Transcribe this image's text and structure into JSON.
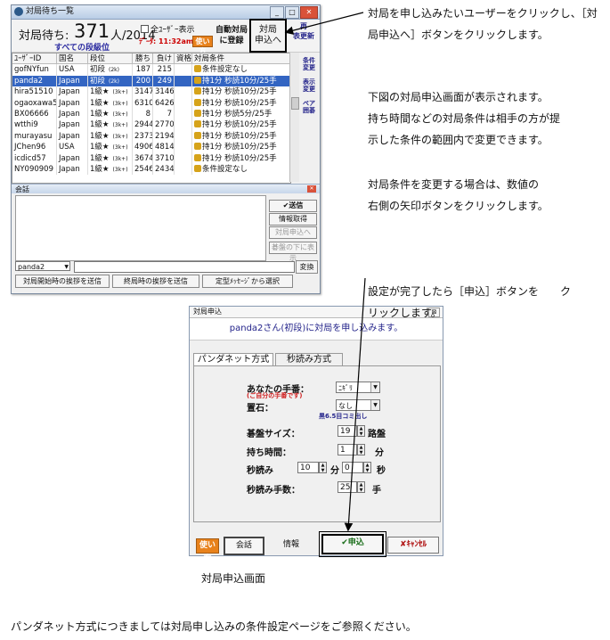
{
  "window": {
    "title": "対局待ち一覧",
    "wait_label": "対局待ち:",
    "wait_count": "371",
    "wait_unit": "人/2014",
    "wait_sub": "すべての段級位",
    "all_users_label": "全ﾕｰｻﾞｰ表示",
    "data_time": "ﾃﾞｰﾀ: 11:32am",
    "usage_btn": "使い方",
    "auto_btn_lines": [
      "自動対局",
      "に登録"
    ],
    "request_btn_lines": [
      "対局",
      "申込へ"
    ],
    "side_buttons": [
      "条件変更",
      "表示変更",
      "ペア囲碁"
    ],
    "side_top_lines": [
      "再",
      "表更新"
    ],
    "columns": [
      "ﾕｰｻﾞｰID",
      "国名",
      "段位",
      "勝ち",
      "負け",
      "資格",
      "対局条件"
    ],
    "rows": [
      {
        "id": "gofNYfun",
        "country": "USA",
        "rank": "初段",
        "rank_note": "(2k)",
        "win": "187",
        "loss": "215",
        "cond": "条件設定なし",
        "selected": false
      },
      {
        "id": "panda2",
        "country": "Japan",
        "rank": "初段",
        "rank_note": "(2k)",
        "win": "200",
        "loss": "249",
        "cond": "持1分 秒読10分/25手",
        "selected": true
      },
      {
        "id": "hira51510",
        "country": "Japan",
        "rank": "1級★",
        "rank_note": "(3k+)",
        "win": "3147",
        "loss": "3146",
        "cond": "持1分 秒読10分/25手",
        "selected": false
      },
      {
        "id": "ogaoxawa57",
        "country": "Japan",
        "rank": "1級★",
        "rank_note": "(3k+)",
        "win": "6310",
        "loss": "6426",
        "cond": "持1分 秒読10分/25手",
        "selected": false
      },
      {
        "id": "BX06666",
        "country": "Japan",
        "rank": "1級★",
        "rank_note": "(3k+)",
        "win": "8",
        "loss": "7",
        "cond": "持1分 秒読5分/25手",
        "selected": false
      },
      {
        "id": "wtthi9",
        "country": "Japan",
        "rank": "1級★",
        "rank_note": "(3k+)",
        "win": "2944",
        "loss": "2770",
        "cond": "持1分 秒読10分/25手",
        "selected": false
      },
      {
        "id": "murayasu",
        "country": "Japan",
        "rank": "1級★",
        "rank_note": "(3k+)",
        "win": "2373",
        "loss": "2194",
        "cond": "持1分 秒読10分/25手",
        "selected": false
      },
      {
        "id": "JChen96",
        "country": "USA",
        "rank": "1級★",
        "rank_note": "(3k+)",
        "win": "4906",
        "loss": "4814",
        "cond": "持1分 秒読10分/25手",
        "selected": false
      },
      {
        "id": "icdicd57",
        "country": "Japan",
        "rank": "1級★",
        "rank_note": "(3k+)",
        "win": "3674",
        "loss": "3710",
        "cond": "持1分 秒読10分/25手",
        "selected": false
      },
      {
        "id": "NY090909",
        "country": "Japan",
        "rank": "1級★",
        "rank_note": "(3k+)",
        "win": "2546",
        "loss": "2434",
        "cond": "条件設定なし",
        "selected": false
      }
    ],
    "chat_title": "会話",
    "send_btn": "✔送信",
    "info_btn": "情報取得",
    "go_request_btn": "対局申込へ",
    "board_below_btn": "碁盤の下に表示",
    "name_value": "panda2",
    "convert_btn": "変換",
    "bottom_buttons": [
      "対局開始時の挨拶を送信",
      "終局時の挨拶を送信",
      "定型ﾒｯｾｰｼﾞから選択"
    ]
  },
  "dialog": {
    "title": "対局申込",
    "close": "⊠",
    "header": "panda2さん(初段)に対局を申し込みます。",
    "tabs": [
      "パンダネット方式",
      "秒読み方式"
    ],
    "your_move_label": "あなたの手番：",
    "your_move_note": "(ご自分の手番です)",
    "your_move_value": "ﾆｷﾞﾘ",
    "handicap_label": "置石：",
    "handicap_value": "なし",
    "handicap_note": "黒6.5目コミ出し",
    "board_label": "碁盤サイズ：",
    "board_value": "19",
    "board_unit": "路盤",
    "time_label": "持ち時間：",
    "time_value": "1",
    "time_unit": "分",
    "byoyomi_label": "秒読み",
    "byoyomi_min": "10",
    "byoyomi_min_unit": "分",
    "byoyomi_sec": "0",
    "byoyomi_sec_unit": "秒",
    "byoyomi_moves_label": "秒読み手数：",
    "byoyomi_moves_value": "25",
    "byoyomi_moves_unit": "手",
    "usage_btn": "使い方",
    "chat_btn": "会話",
    "info_btn": "情報",
    "submit_btn": "✔申込",
    "cancel_btn": "✘ｷｬﾝｾﾙ"
  },
  "notes": {
    "note1": [
      "対局を申し込みたいユーザーをクリックし、［対",
      "局申込へ］ボタンをクリックします。"
    ],
    "note2": [
      "下図の対局申込画面が表示されます。",
      "持ち時間などの対局条件は相手の方が提",
      "示した条件の範囲内で変更できます。"
    ],
    "note3": [
      "対局条件を変更する場合は、数値の",
      "右側の矢印ボタンをクリックします。"
    ],
    "note4": [
      "設定が完了したら［申込］ボタンを　　ク",
      "リックします。"
    ],
    "caption": "対局申込画面",
    "footer": "パンダネット方式につきましては対局申し込みの条件設定ページをご参照ください。"
  }
}
